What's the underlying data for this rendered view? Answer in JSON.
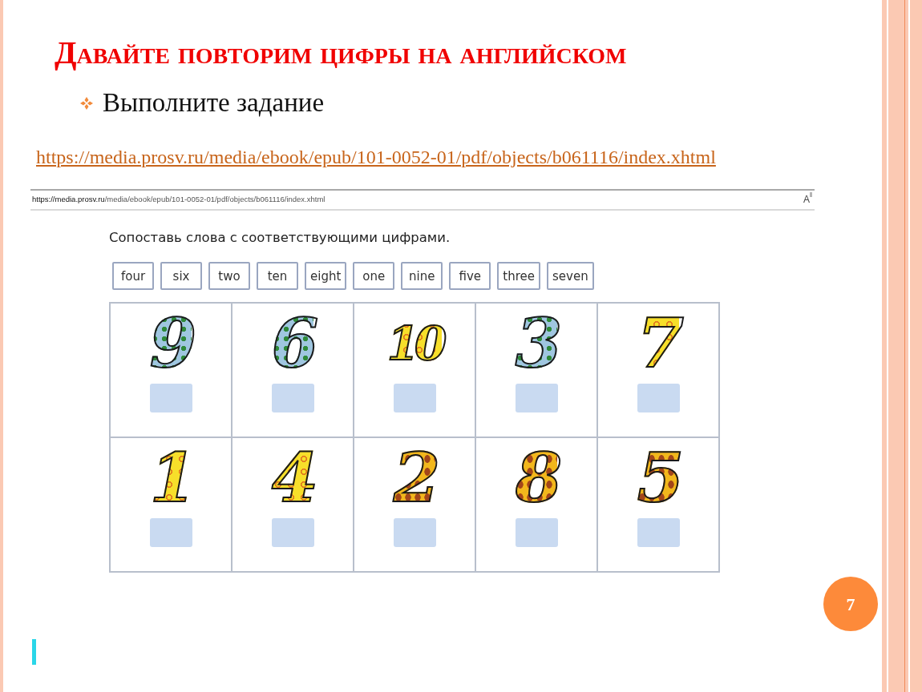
{
  "slide": {
    "title": "Давайте повторим цифры на английском",
    "bullet": "Выполните задание",
    "link": "https://media.prosv.ru/media/ebook/epub/101-0052-01/pdf/objects/b061116/index.xhtml",
    "page_number": "7"
  },
  "browser": {
    "url_host": "https://media.prosv.ru",
    "url_path": "/media/ebook/epub/101-0052-01/pdf/objects/b061116/index.xhtml",
    "reader_label": "A"
  },
  "exercise": {
    "instruction": "Сопоставь слова с соответствующими цифрами.",
    "words": [
      "four",
      "six",
      "two",
      "ten",
      "eight",
      "one",
      "nine",
      "five",
      "three",
      "seven"
    ],
    "cells": [
      {
        "digit": "9",
        "kind": "checker"
      },
      {
        "digit": "6",
        "kind": "checker"
      },
      {
        "digit": "10",
        "kind": "swirl"
      },
      {
        "digit": "3",
        "kind": "checker"
      },
      {
        "digit": "7",
        "kind": "swirl"
      },
      {
        "digit": "1",
        "kind": "swirl"
      },
      {
        "digit": "4",
        "kind": "swirl"
      },
      {
        "digit": "2",
        "kind": "flame"
      },
      {
        "digit": "8",
        "kind": "flame"
      },
      {
        "digit": "5",
        "kind": "flame"
      }
    ]
  }
}
